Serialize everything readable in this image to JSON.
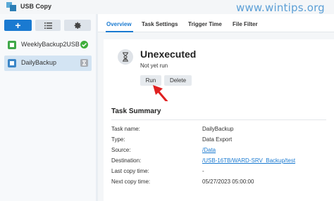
{
  "app": {
    "title": "USB Copy",
    "watermark": "www.wintips.org"
  },
  "toolbar": {
    "add_label": "+"
  },
  "tasks": [
    {
      "label": "WeeklyBackup2USB",
      "status": "ok"
    },
    {
      "label": "DailyBackup",
      "status": "idle",
      "selected": true
    }
  ],
  "tabs": [
    {
      "label": "Overview",
      "active": true
    },
    {
      "label": "Task Settings"
    },
    {
      "label": "Trigger Time"
    },
    {
      "label": "File Filter"
    }
  ],
  "status": {
    "title": "Unexecuted",
    "subtitle": "Not yet run",
    "run_label": "Run",
    "delete_label": "Delete"
  },
  "summary": {
    "title": "Task Summary",
    "rows": [
      {
        "label": "Task name:",
        "value": "DailyBackup"
      },
      {
        "label": "Type:",
        "value": "Data Export"
      },
      {
        "label": "Source:",
        "value": "/Data"
      },
      {
        "label": "Destination:",
        "value": "/USB-16TB/WARD-SRV_Backup/test"
      },
      {
        "label": "Last copy time:",
        "value": "-"
      },
      {
        "label": "Next copy time:",
        "value": "05/27/2023 05:00:00"
      }
    ]
  },
  "colors": {
    "accent": "#1a7ad1",
    "ok": "#3fae3b",
    "arrow": "#e02020"
  }
}
